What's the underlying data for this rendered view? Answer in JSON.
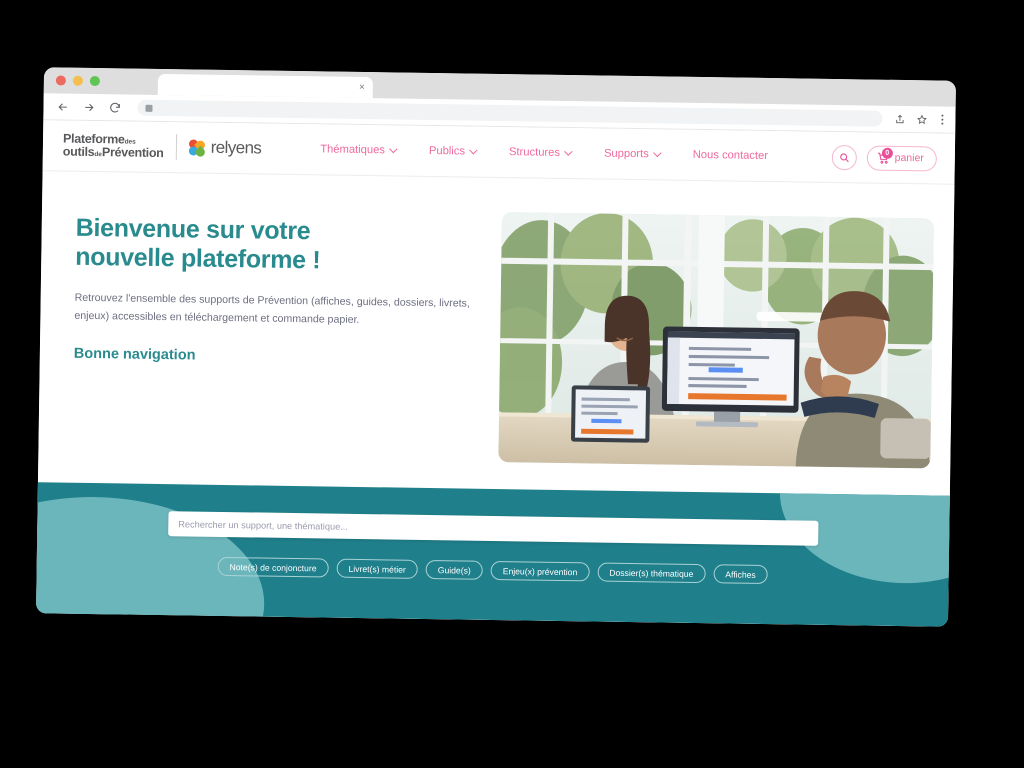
{
  "browser": {
    "tab_title": "",
    "tab_close_glyph": "×",
    "url_value": "",
    "back_icon": "back-arrow-icon",
    "forward_icon": "forward-arrow-icon",
    "reload_icon": "reload-icon",
    "share_icon": "share-icon",
    "bookmark_icon": "bookmark-star-icon",
    "menu_icon": "kebab-menu-icon"
  },
  "header": {
    "brand": {
      "line1_main": "Plateforme",
      "line1_small": "des",
      "line2_small": "outils",
      "line2_small2": "de",
      "line2_main": "Prévention",
      "partner": "relyens"
    },
    "nav": [
      {
        "label": "Thématiques",
        "has_caret": true
      },
      {
        "label": "Publics",
        "has_caret": true
      },
      {
        "label": "Structures",
        "has_caret": true
      },
      {
        "label": "Supports",
        "has_caret": true
      },
      {
        "label": "Nous contacter",
        "has_caret": false
      }
    ],
    "search_icon": "magnifier-icon",
    "cart": {
      "label": "panier",
      "count": "0",
      "icon": "shopping-cart-icon"
    },
    "accent_color": "#ef6a9e"
  },
  "hero": {
    "title_line1": "Bienvenue sur votre",
    "title_line2": "nouvelle plateforme !",
    "paragraph": "Retrouvez l'ensemble des supports de Prévention (affiches, guides, dossiers, livrets, enjeux) accessibles en téléchargement et commande papier.",
    "cta": "Bonne navigation",
    "title_color": "#2a8b8f",
    "image_alt": "Deux collègues souriants assis à un bureau devant des écrans d'ordinateur, devant de grandes baies vitrées"
  },
  "search_band": {
    "placeholder": "Rechercher un support, une thématique...",
    "value": "",
    "background_color": "#1f7f8b",
    "blob_color": "#6bb6bb",
    "chips": [
      "Note(s) de conjoncture",
      "Livret(s) métier",
      "Guide(s)",
      "Enjeu(x) prévention",
      "Dossier(s) thématique",
      "Affiches"
    ]
  }
}
